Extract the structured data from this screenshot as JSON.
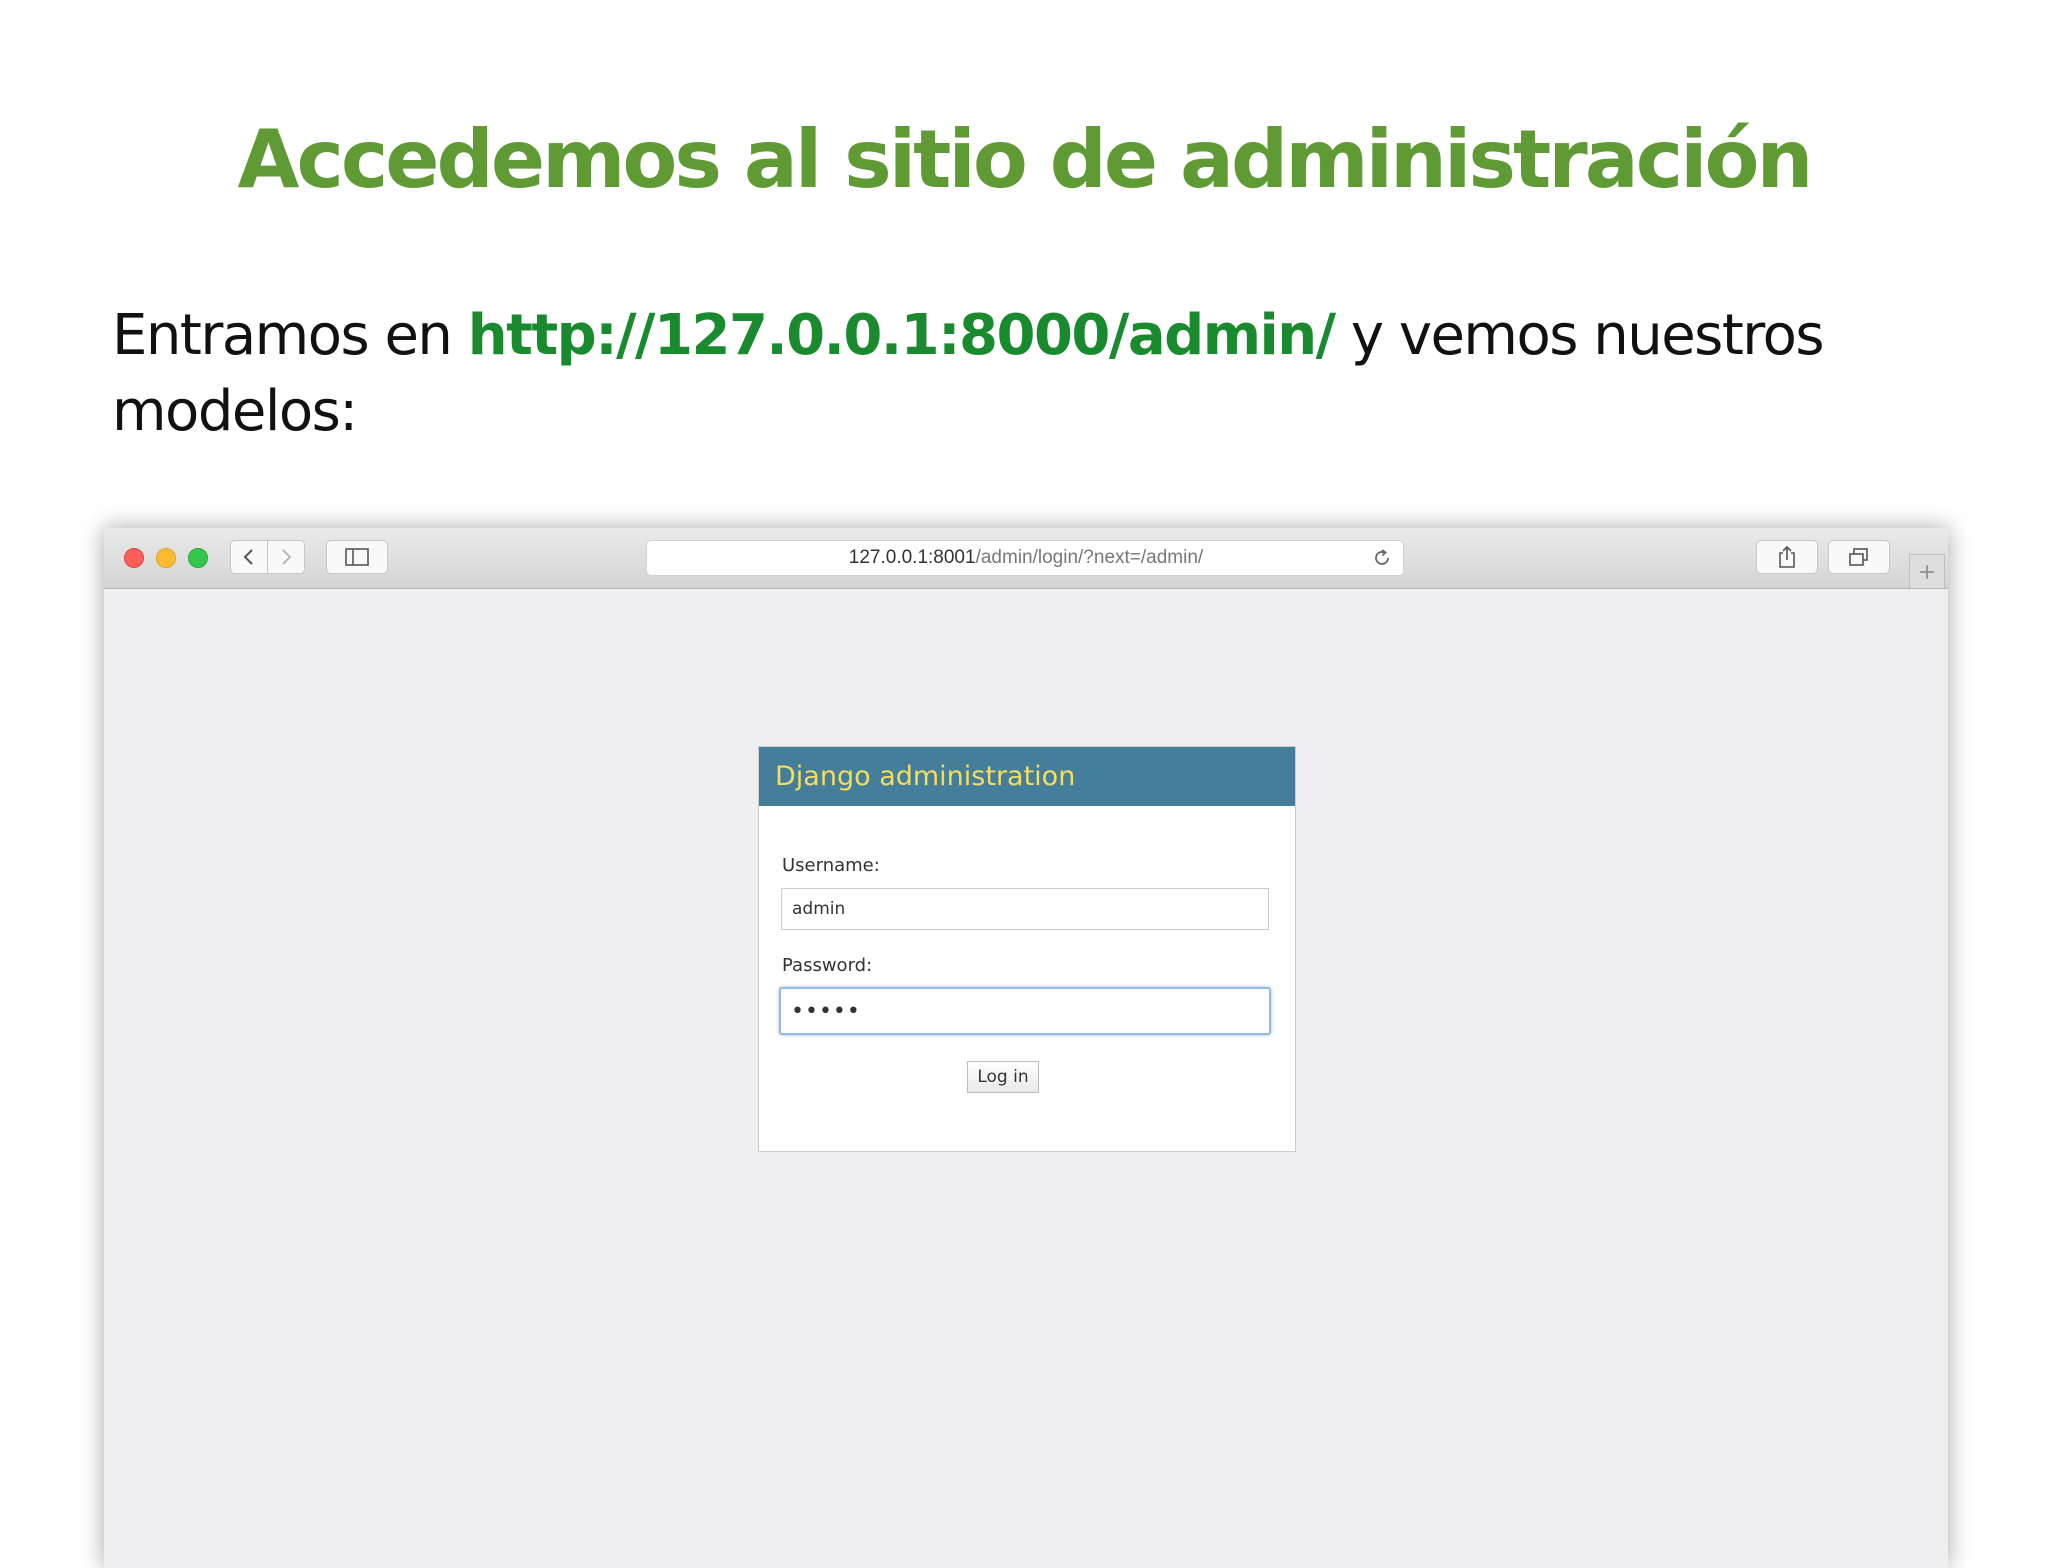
{
  "slide": {
    "title": "Accedemos al sitio de administración",
    "body_before": "Entramos en ",
    "body_url": "http://127.0.0.1:8000/admin/",
    "body_after": " y vemos nuestros modelos:"
  },
  "browser": {
    "address_host": "127.0.0.1:8001",
    "address_path": "/admin/login/?next=/admin/",
    "icons": {
      "back": "chevron-left-icon",
      "forward": "chevron-right-icon",
      "sidebar": "sidebar-icon",
      "reload": "reload-icon",
      "share": "share-icon",
      "tabs": "tabs-icon",
      "new_tab": "plus-icon"
    }
  },
  "login": {
    "header": "Django administration",
    "username_label": "Username:",
    "username_value": "admin",
    "password_label": "Password:",
    "password_value": "•••••",
    "button_label": "Log in"
  },
  "colors": {
    "title_green": "#5f9a35",
    "url_green": "#1a8a2e",
    "django_header_bg": "#447e9b",
    "django_header_text": "#f5dd5d",
    "browser_bg": "#efeff2"
  }
}
